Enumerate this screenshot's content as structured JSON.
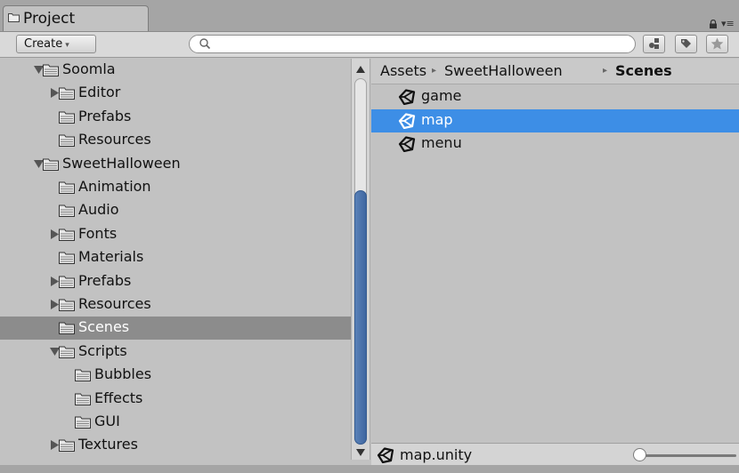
{
  "window": {
    "tab_label": "Project"
  },
  "toolbar": {
    "create_label": "Create",
    "create_arrow": "▾",
    "search_value": ""
  },
  "tree": [
    {
      "label": "Soomla",
      "depth": 0,
      "arrow": "expanded",
      "selected": false
    },
    {
      "label": "Editor",
      "depth": 1,
      "arrow": "collapsed",
      "selected": false
    },
    {
      "label": "Prefabs",
      "depth": 1,
      "arrow": "none",
      "selected": false
    },
    {
      "label": "Resources",
      "depth": 1,
      "arrow": "none",
      "selected": false
    },
    {
      "label": "SweetHalloween",
      "depth": 0,
      "arrow": "expanded",
      "selected": false
    },
    {
      "label": "Animation",
      "depth": 1,
      "arrow": "none",
      "selected": false
    },
    {
      "label": "Audio",
      "depth": 1,
      "arrow": "none",
      "selected": false
    },
    {
      "label": "Fonts",
      "depth": 1,
      "arrow": "collapsed",
      "selected": false
    },
    {
      "label": "Materials",
      "depth": 1,
      "arrow": "none",
      "selected": false
    },
    {
      "label": "Prefabs",
      "depth": 1,
      "arrow": "collapsed",
      "selected": false
    },
    {
      "label": "Resources",
      "depth": 1,
      "arrow": "collapsed",
      "selected": false
    },
    {
      "label": "Scenes",
      "depth": 1,
      "arrow": "none",
      "selected": true
    },
    {
      "label": "Scripts",
      "depth": 1,
      "arrow": "expanded",
      "selected": false
    },
    {
      "label": "Bubbles",
      "depth": 2,
      "arrow": "none",
      "selected": false
    },
    {
      "label": "Effects",
      "depth": 2,
      "arrow": "none",
      "selected": false
    },
    {
      "label": "GUI",
      "depth": 2,
      "arrow": "none",
      "selected": false
    },
    {
      "label": "Textures",
      "depth": 1,
      "arrow": "collapsed",
      "selected": false
    }
  ],
  "breadcrumb": {
    "items": [
      "Assets",
      "SweetHalloween",
      "Scenes"
    ],
    "separator": "▸"
  },
  "files": [
    {
      "label": "game",
      "selected": false
    },
    {
      "label": "map",
      "selected": true
    },
    {
      "label": "menu",
      "selected": false
    }
  ],
  "status": {
    "selected_file": "map.unity"
  },
  "zoom_slider": {
    "value": 0.0
  },
  "colors": {
    "selection": "#3d8ee6",
    "tree_selection": "#8c8c8c",
    "scroll_thumb": "#4a72ab"
  }
}
